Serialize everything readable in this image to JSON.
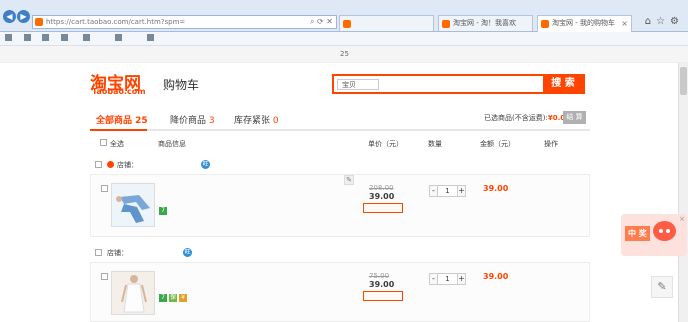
{
  "browser": {
    "address": "https://cart.taobao.com/cart.htm?spm=",
    "tabs": [
      {
        "label": ""
      },
      {
        "label": "淘宝网 - 淘！我喜欢"
      },
      {
        "label": "淘宝网 - 我的购物车"
      }
    ],
    "toolbar": [
      "",
      "",
      "",
      "",
      "",
      "",
      ""
    ]
  },
  "site_nav": {
    "user": "",
    "message": "",
    "links": [
      "",
      "",
      "",
      "",
      "",
      "",
      "",
      "",
      ""
    ],
    "cart_count": "25"
  },
  "header": {
    "logo_cn": "淘宝网",
    "logo_en": "Taobao.com",
    "page_title": "购物车",
    "search_scope": "宝贝",
    "search_placeholder": "",
    "search_button": "搜 索"
  },
  "cart_tabs": [
    {
      "label": "全部商品",
      "count": "25"
    },
    {
      "label": "降价商品",
      "count": "3"
    },
    {
      "label": "库存紧张",
      "count": "0"
    }
  ],
  "summary": {
    "label": "已选商品(不含运费):",
    "amount": "¥0.00",
    "button": "结 算"
  },
  "columns": [
    "全选",
    "商品信息",
    "单价（元）",
    "数量",
    "金额（元）",
    "操作"
  ],
  "shops": [
    {
      "label": "店铺：",
      "name": "",
      "item": {
        "title": "",
        "props": [
          "",
          ""
        ],
        "old_price": "208.00",
        "price": "39.00",
        "promo": "",
        "quantity": "1",
        "subtotal": "39.00",
        "actions": [
          "",
          ""
        ]
      }
    },
    {
      "label": "店铺：",
      "name": "",
      "extra": "",
      "item": {
        "title": "",
        "props": [
          "",
          ""
        ],
        "old_price": "75.00",
        "price": "39.00",
        "promo": "",
        "quantity": "1",
        "subtotal": "39.00",
        "actions": [
          "",
          ""
        ]
      }
    }
  ],
  "mascot": {
    "text": "中 奖"
  },
  "icons": {
    "shop": "shop-icon",
    "wangwang": "wangwang-icon",
    "edit": "pencil-icon"
  },
  "colors": {
    "brand": "#ff4400",
    "browser": "#dfe9f5"
  }
}
